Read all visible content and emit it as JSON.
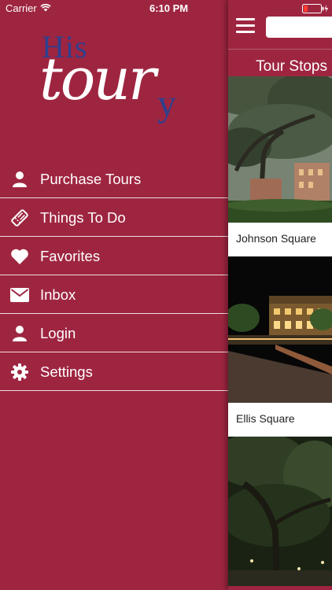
{
  "status_bar": {
    "carrier": "Carrier",
    "time": "6:10 PM"
  },
  "logo": {
    "part1": "His",
    "part2": "tour",
    "part3": "y"
  },
  "menu": {
    "items": [
      {
        "label": "Purchase Tours",
        "icon": "person-icon"
      },
      {
        "label": "Things To Do",
        "icon": "ticket-icon"
      },
      {
        "label": "Favorites",
        "icon": "heart-icon"
      },
      {
        "label": "Inbox",
        "icon": "envelope-icon"
      },
      {
        "label": "Login",
        "icon": "person-icon"
      },
      {
        "label": "Settings",
        "icon": "gear-icon"
      }
    ]
  },
  "panel": {
    "title": "Tour Stops",
    "search_placeholder": "",
    "stops": [
      {
        "name": "Johnson Square"
      },
      {
        "name": "Ellis Square"
      },
      {
        "name": ""
      }
    ]
  },
  "colors": {
    "brand": "#9e2540",
    "logo_blue": "#2f3f8e",
    "divider": "#f1dde2"
  }
}
